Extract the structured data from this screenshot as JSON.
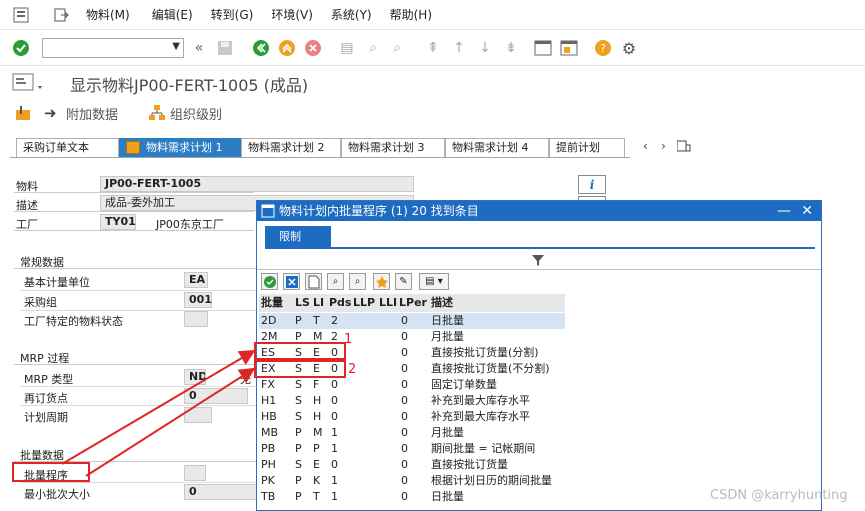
{
  "menu": {
    "items": [
      "物料(M)",
      "编辑(E)",
      "转到(G)",
      "环境(V)",
      "系统(Y)",
      "帮助(H)"
    ]
  },
  "title": "显示物料JP00-FERT-1005 (成品)",
  "app_toolbar": {
    "additional_data": "附加数据",
    "org_levels": "组织级别"
  },
  "tabs": [
    "采购订单文本",
    "物料需求计划 1",
    "物料需求计划 2",
    "物料需求计划 3",
    "物料需求计划 4",
    "提前计划"
  ],
  "header_fields": {
    "material_label": "物料",
    "material_value": "JP00-FERT-1005",
    "desc_label": "描述",
    "desc_value": "成品-委外加工",
    "plant_label": "工厂",
    "plant_value": "TY01",
    "plant_name": "JP00东京工厂"
  },
  "general": {
    "title": "常规数据",
    "base_uom_label": "基本计量单位",
    "base_uom_value": "EA",
    "purch_group_label": "采购组",
    "purch_group_value": "001",
    "plant_status_label": "工厂特定的物料状态"
  },
  "mrp": {
    "title": "MRP 过程",
    "type_label": "MRP 类型",
    "type_value": "ND",
    "reorder_label": "再订货点",
    "reorder_value": "0",
    "period_label": "计划周期",
    "extra": "无"
  },
  "lot": {
    "title": "批量数据",
    "procedure_label": "批量程序",
    "min_lot_label": "最小批次大小",
    "min_lot_value": "0"
  },
  "popup": {
    "title": "物料计划内批量程序 (1)  20 找到条目",
    "tab": "限制",
    "columns": [
      "批量",
      "LS",
      "LI",
      "Pds",
      "LLP",
      "LLI",
      "LPer",
      "描述"
    ],
    "rows": [
      {
        "code": "2D",
        "ls": "P",
        "li": "T",
        "pds": "2",
        "lper": "0",
        "desc": "日批量"
      },
      {
        "code": "2M",
        "ls": "P",
        "li": "M",
        "pds": "2",
        "lper": "0",
        "desc": "月批量"
      },
      {
        "code": "ES",
        "ls": "S",
        "li": "E",
        "pds": "0",
        "lper": "0",
        "desc": "直接按批订货量(分割)"
      },
      {
        "code": "EX",
        "ls": "S",
        "li": "E",
        "pds": "0",
        "lper": "0",
        "desc": "直接按批订货量(不分割)"
      },
      {
        "code": "FX",
        "ls": "S",
        "li": "F",
        "pds": "0",
        "lper": "0",
        "desc": "固定订单数量"
      },
      {
        "code": "H1",
        "ls": "S",
        "li": "H",
        "pds": "0",
        "lper": "0",
        "desc": "补充到最大库存水平"
      },
      {
        "code": "HB",
        "ls": "S",
        "li": "H",
        "pds": "0",
        "lper": "0",
        "desc": "补充到最大库存水平"
      },
      {
        "code": "MB",
        "ls": "P",
        "li": "M",
        "pds": "1",
        "lper": "0",
        "desc": "月批量"
      },
      {
        "code": "PB",
        "ls": "P",
        "li": "P",
        "pds": "1",
        "lper": "0",
        "desc": "期间批量 = 记帐期间"
      },
      {
        "code": "PH",
        "ls": "S",
        "li": "E",
        "pds": "0",
        "lper": "0",
        "desc": "直接按批订货量"
      },
      {
        "code": "PK",
        "ls": "P",
        "li": "K",
        "pds": "1",
        "lper": "0",
        "desc": "根据计划日历的期间批量"
      },
      {
        "code": "TB",
        "ls": "P",
        "li": "T",
        "pds": "1",
        "lper": "0",
        "desc": "日批量"
      }
    ]
  },
  "annotations": {
    "num1": "1",
    "num2": "2"
  },
  "watermark": "CSDN @karryhunting",
  "colors": {
    "sap_blue": "#1e6bc2",
    "annotation_red": "#e12424"
  }
}
